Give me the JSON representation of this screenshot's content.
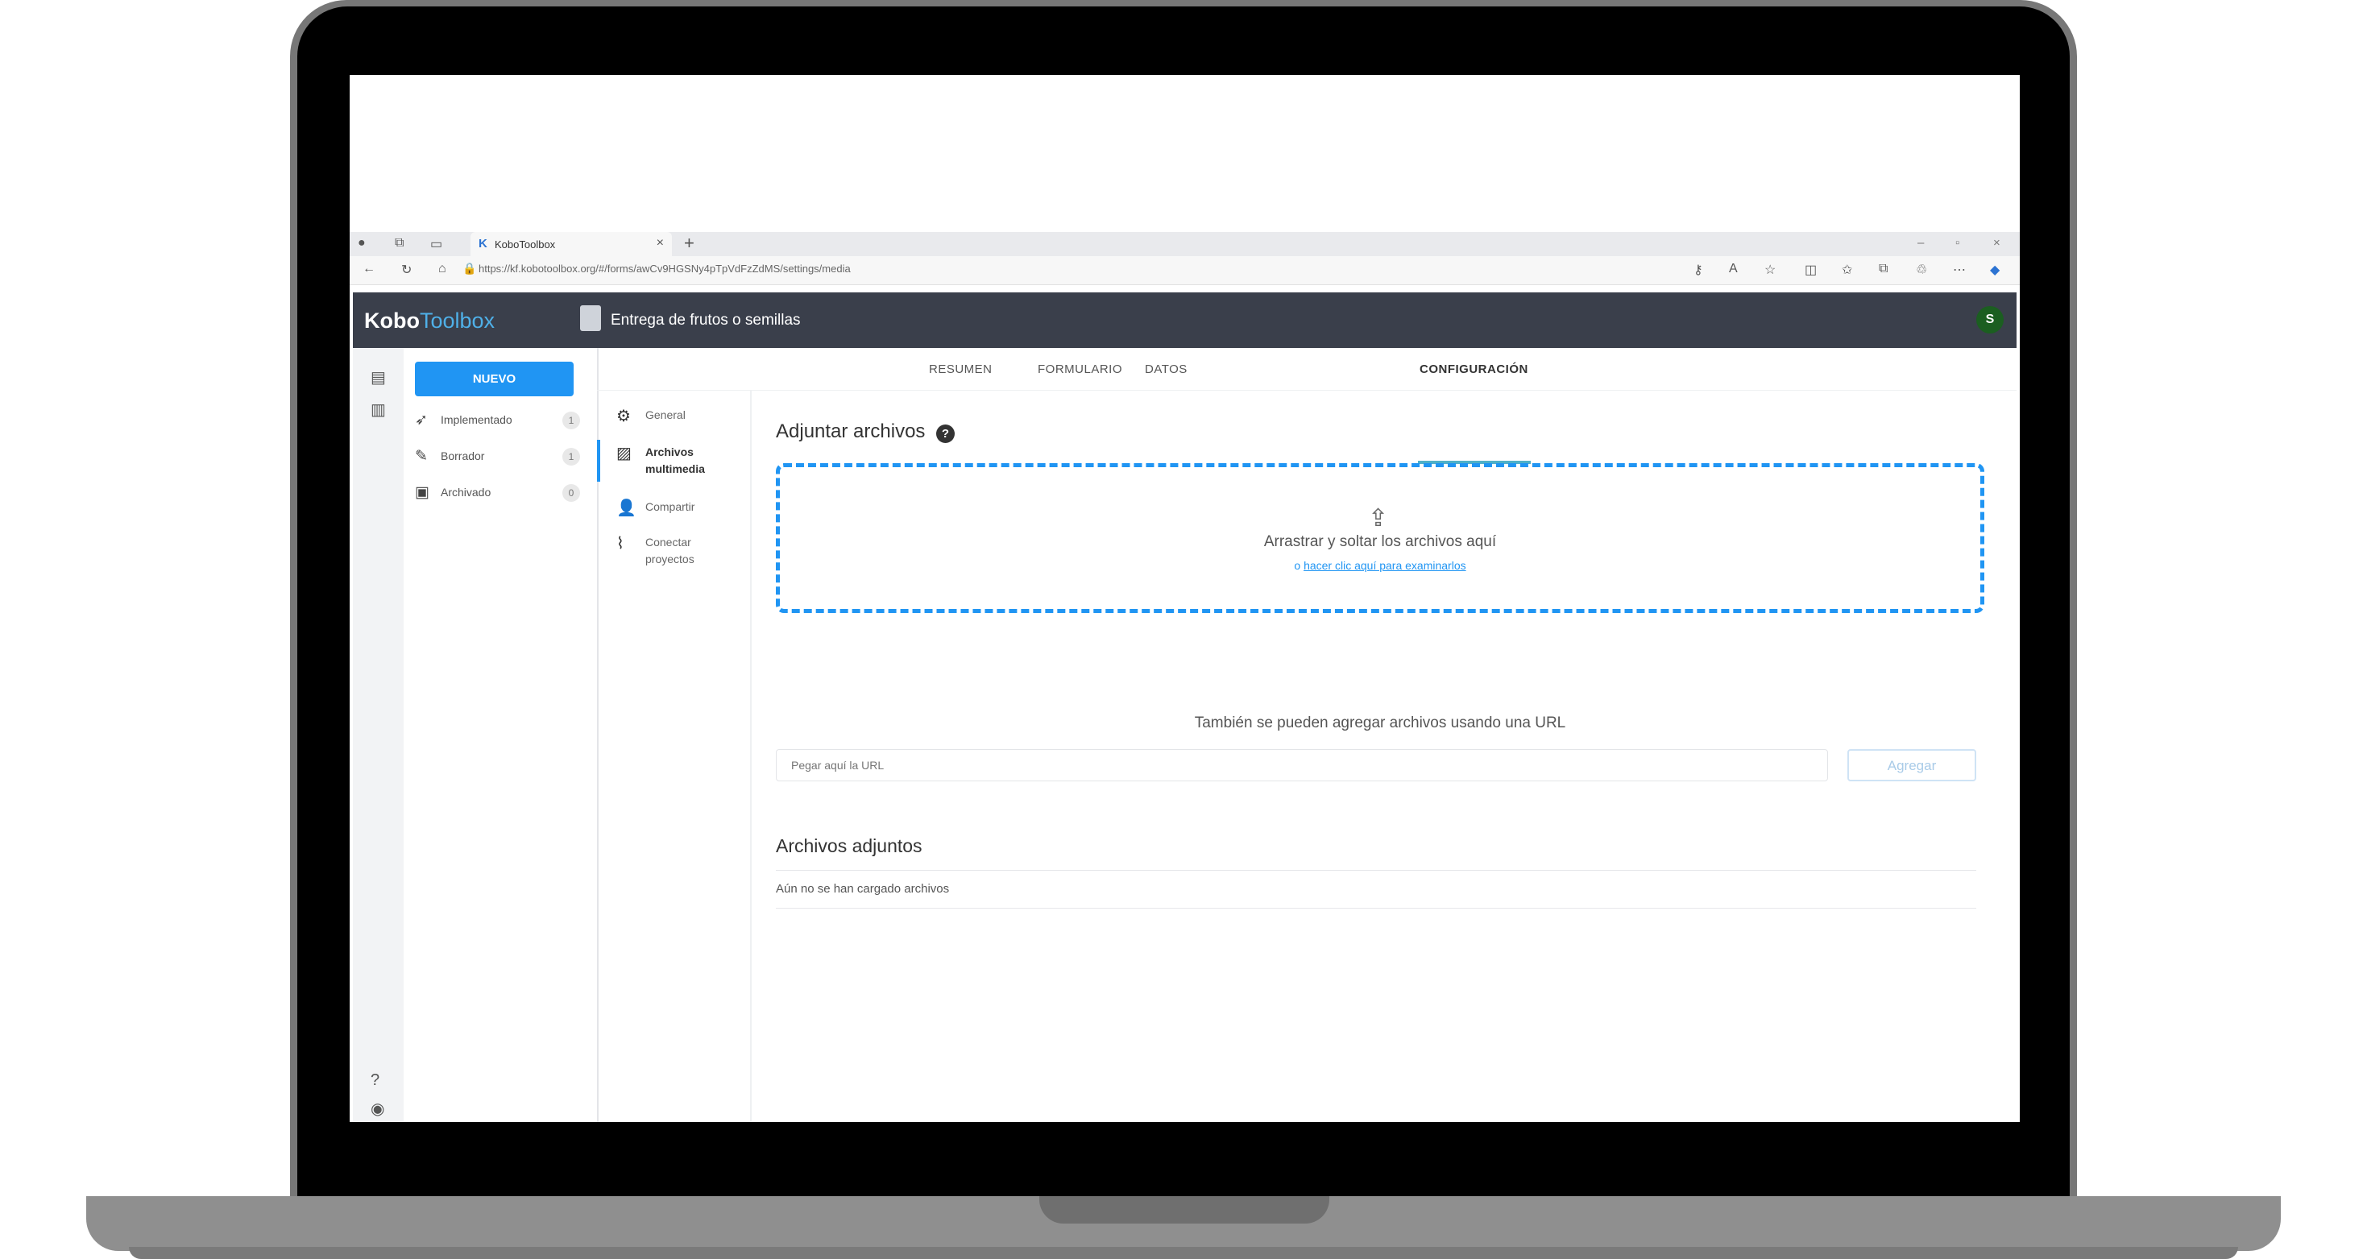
{
  "browser": {
    "tab_title": "KoboToolbox",
    "url": "https://kf.kobotoolbox.org/#/forms/awCv9HGSNy4pTpVdFzZdMS/settings/media"
  },
  "header": {
    "logo_primary": "Kobo",
    "logo_secondary": "Toolbox",
    "project_title": "Entrega de frutos o semillas",
    "avatar_initial": "S"
  },
  "sidebar": {
    "new_button": "NUEVO",
    "items": [
      {
        "label": "Implementado",
        "count": "1"
      },
      {
        "label": "Borrador",
        "count": "1"
      },
      {
        "label": "Archivado",
        "count": "0"
      }
    ]
  },
  "tabs": [
    "RESUMEN",
    "FORMULARIO",
    "DATOS",
    "CONFIGURACIÓN"
  ],
  "settings_nav": [
    {
      "label": "General"
    },
    {
      "label": "Archivos multimedia"
    },
    {
      "label": "Compartir"
    },
    {
      "label": "Conectar proyectos"
    }
  ],
  "attach": {
    "title": "Adjuntar archivos",
    "help": "?",
    "drop_text": "Arrastrar y soltar los archivos aquí",
    "drop_or": "o",
    "drop_link": "hacer clic aquí para examinarlos",
    "also_text": "También se pueden agregar archivos usando una URL",
    "url_placeholder": "Pegar aquí la URL",
    "add_button": "Agregar"
  },
  "files": {
    "title": "Archivos adjuntos",
    "empty": "Aún no se han cargado archivos"
  }
}
